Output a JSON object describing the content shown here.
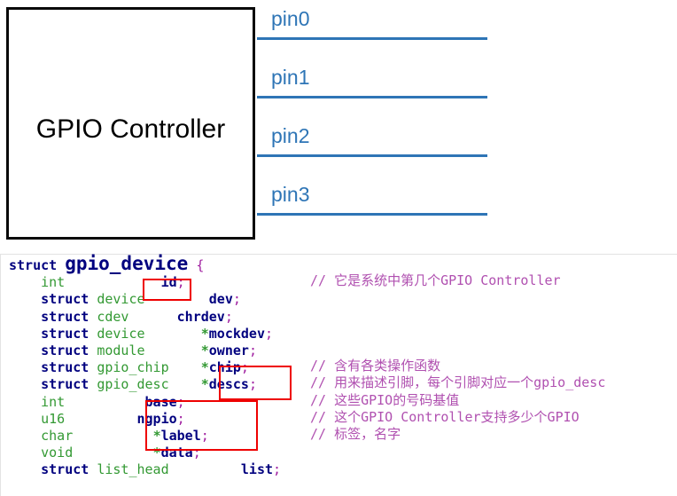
{
  "diagram": {
    "controller_label": "GPIO Controller",
    "pin_color": "#2e75b6",
    "box_border_color": "#0a0a0a",
    "pins": [
      {
        "label": "pin0"
      },
      {
        "label": "pin1"
      },
      {
        "label": "pin2"
      },
      {
        "label": "pin3"
      }
    ]
  },
  "code": {
    "language": "c",
    "struct_keyword": "struct",
    "struct_name": "gpio_device",
    "open_brace": "{",
    "lines": [
      {
        "indent": "    ",
        "keyword": "",
        "type": "int",
        "gap": "            ",
        "star": "",
        "name": "id",
        "semi": ";"
      },
      {
        "indent": "    ",
        "keyword": "struct",
        "type": "device",
        "gap": "        ",
        "star": "",
        "name": "dev",
        "semi": ";"
      },
      {
        "indent": "    ",
        "keyword": "struct",
        "type": "cdev",
        "gap": "      ",
        "star": "",
        "name": "chrdev",
        "semi": ";"
      },
      {
        "indent": "    ",
        "keyword": "struct",
        "type": "device",
        "gap": "       ",
        "star": "*",
        "name": "mockdev",
        "semi": ";"
      },
      {
        "indent": "    ",
        "keyword": "struct",
        "type": "module",
        "gap": "       ",
        "star": "*",
        "name": "owner",
        "semi": ";"
      },
      {
        "indent": "    ",
        "keyword": "struct",
        "type": "gpio_chip",
        "gap": "    ",
        "star": "*",
        "name": "chip",
        "semi": ";"
      },
      {
        "indent": "    ",
        "keyword": "struct",
        "type": "gpio_desc",
        "gap": "    ",
        "star": "*",
        "name": "descs",
        "semi": ";"
      },
      {
        "indent": "    ",
        "keyword": "",
        "type": "int",
        "gap": "          ",
        "star": "",
        "name": "base",
        "semi": ";"
      },
      {
        "indent": "    ",
        "keyword": "",
        "type": "u16",
        "gap": "         ",
        "star": "",
        "name": "ngpio",
        "semi": ";"
      },
      {
        "indent": "    ",
        "keyword": "",
        "type": "char",
        "gap": "          ",
        "star": "*",
        "name": "label",
        "semi": ";"
      },
      {
        "indent": "    ",
        "keyword": "",
        "type": "void",
        "gap": "          ",
        "star": "*",
        "name": "data",
        "semi": ";"
      },
      {
        "indent": "    ",
        "keyword": "struct",
        "type": "list_head",
        "gap": "         ",
        "star": "",
        "name": "list",
        "semi": ";"
      }
    ],
    "comments": [
      "// 它是系统中第几个GPIO Controller",
      "",
      "",
      "",
      "",
      "// 含有各类操作函数",
      "// 用来描述引脚，每个引脚对应一个gpio_desc",
      "// 这些GPIO的号码基值",
      "// 这个GPIO Controller支持多少个GPIO",
      "// 标签，名字",
      "",
      ""
    ]
  },
  "annotations": {
    "color": "#ee0000",
    "boxes": [
      {
        "name": "highlight-id",
        "label": "id;"
      },
      {
        "name": "highlight-chip-descs",
        "label": "*chip; *descs;"
      },
      {
        "name": "highlight-base-ngpio-label",
        "label": "base; ngpio; *label;"
      }
    ]
  }
}
